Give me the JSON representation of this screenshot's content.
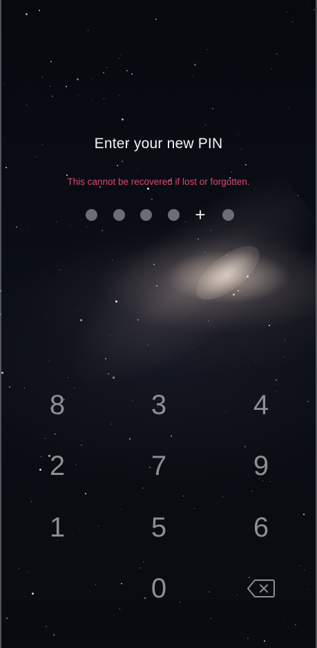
{
  "header": {
    "title": "Enter your new PIN",
    "warning": "This cannot be recovered if lost or forgotten."
  },
  "pin_indicator": {
    "slots": [
      "dot",
      "dot",
      "dot",
      "dot",
      "plus",
      "dot"
    ],
    "plus_glyph": "+"
  },
  "keypad": {
    "keys": [
      "8",
      "3",
      "4",
      "2",
      "7",
      "9",
      "1",
      "5",
      "6",
      "0"
    ],
    "backspace_icon": "backspace-icon"
  },
  "colors": {
    "title": "#f4f4f6",
    "warning": "#d94a6c",
    "pin_dot": "#6b6e74",
    "key_text": "#8d8f94"
  }
}
